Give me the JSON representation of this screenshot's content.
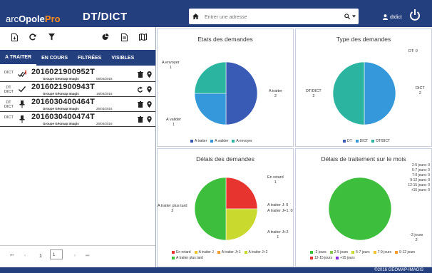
{
  "header": {
    "logo_part1": "arc",
    "logo_part2": "Opole",
    "logo_part3": "Pro",
    "title": "DT/DICT",
    "search_placeholder": "Entrer une adresse",
    "user": "dtdict"
  },
  "toolbar": {
    "icons": [
      "add-document-icon",
      "refresh-icon",
      "filter-icon",
      "pie-chart-icon",
      "report-icon",
      "map-icon"
    ]
  },
  "tabs": [
    "A TRAITER",
    "EN COURS",
    "FILTRÉES",
    "VISIBLES"
  ],
  "requests": [
    {
      "type_line1": "DICT",
      "type_line2": "",
      "status": "check",
      "number": "2016021900952T",
      "group": "Groupe Geomap Imagis",
      "date": "06/04/2016",
      "action": "delete-icon"
    },
    {
      "type_line1": "DT",
      "type_line2": "DICT",
      "status": "check",
      "number": "2016021900943T",
      "group": "Groupe Géomap Imagis",
      "date": "18/04/2016",
      "action": "undo-icon"
    },
    {
      "type_line1": "DT",
      "type_line2": "DICT",
      "status": "pin",
      "number": "2016030400464T",
      "group": "Groupe Géomap Imagis",
      "date": "26/04/2016",
      "action": "delete-icon"
    },
    {
      "type_line1": "DICT",
      "type_line2": "",
      "status": "pin",
      "number": "2016030400474T",
      "group": "Groupe Géomap Imagis",
      "date": "26/04/2016",
      "action": "delete-icon"
    }
  ],
  "pager": {
    "current": "1",
    "input_value": "1"
  },
  "panels": {
    "etats": {
      "title": "Etats des demandes",
      "label_a_envoyer": "A envoyer",
      "value_a_envoyer": "1",
      "label_a_traiter": "A traiter",
      "value_a_traiter": "2",
      "label_a_valider": "A valider",
      "value_a_valider": "1",
      "legend": [
        "A traiter",
        "A valider",
        "A envoyer"
      ]
    },
    "type": {
      "title": "Type des demandes",
      "label_dt": "DT: 0",
      "label_dtdict": "DT/DICT",
      "value_dtdict": "2",
      "label_dict": "DICT",
      "value_dict": "2",
      "legend": [
        "DT",
        "DICT",
        "DT/DICT"
      ]
    },
    "delais": {
      "title": "Délais des demandes",
      "label_en_retard": "En retard",
      "value_en_retard": "1",
      "label_traiter_plus_tard": "A traiter plus tard",
      "value_traiter_plus_tard": "2",
      "label_j0": "A traiter J: 0",
      "label_j1": "A traiter J+1: 0",
      "label_j2": "A traiter J+2",
      "value_j2": "1",
      "legend": [
        "En retard",
        "A traiter J",
        "A traiter J+1",
        "A traiter J+2",
        "A traiter plus tard"
      ]
    },
    "traitement": {
      "title": "Délais de traitement sur le mois",
      "right_list": [
        "2-5 jours: 0",
        "5-7 jours: 0",
        "7-9 jours: 0",
        "9-12 jours: 0",
        "12-15 jours: 0",
        "+15 jours: 0"
      ],
      "label_lt2": "-2 jours",
      "value_lt2": "2",
      "legend": [
        "-2 jours",
        "2-5 jours",
        "5-7 jours",
        "7-9 jours",
        "9-12 jours",
        "12-15 jours",
        "+15 jours"
      ]
    }
  },
  "footer": {
    "text": "©2016 GEOMAP-IMAGIS"
  },
  "colors": {
    "navy": "#243f7e",
    "a_traiter": "#3a5bb5",
    "a_valider": "#3498db",
    "a_envoyer": "#2bb5a0",
    "dt": "#3a5bb5",
    "dict": "#3498db",
    "dtdict": "#2bb5a0",
    "en_retard": "#e8342e",
    "traiter_j": "#f2c12e",
    "traiter_j1": "#f29a2e",
    "traiter_j2": "#c9d92e",
    "plus_tard": "#3dbf3d",
    "j_lt2": "#3dbf3d",
    "j_2_5": "#86c94a",
    "j_5_7": "#c9d92e",
    "j_7_9": "#f2c12e",
    "j_9_12": "#f29a2e",
    "j_12_15": "#e8342e",
    "j_15": "#8a2be2"
  },
  "chart_data": [
    {
      "type": "pie",
      "title": "Etats des demandes",
      "categories": [
        "A traiter",
        "A valider",
        "A envoyer"
      ],
      "values": [
        2,
        1,
        1
      ]
    },
    {
      "type": "pie",
      "title": "Type des demandes",
      "categories": [
        "DT",
        "DICT",
        "DT/DICT"
      ],
      "values": [
        0,
        2,
        2
      ]
    },
    {
      "type": "pie",
      "title": "Délais des demandes",
      "categories": [
        "En retard",
        "A traiter J",
        "A traiter J+1",
        "A traiter J+2",
        "A traiter plus tard"
      ],
      "values": [
        1,
        0,
        0,
        1,
        2
      ]
    },
    {
      "type": "pie",
      "title": "Délais de traitement sur le mois",
      "categories": [
        "-2 jours",
        "2-5 jours",
        "5-7 jours",
        "7-9 jours",
        "9-12 jours",
        "12-15 jours",
        "+15 jours"
      ],
      "values": [
        2,
        0,
        0,
        0,
        0,
        0,
        0
      ]
    }
  ]
}
